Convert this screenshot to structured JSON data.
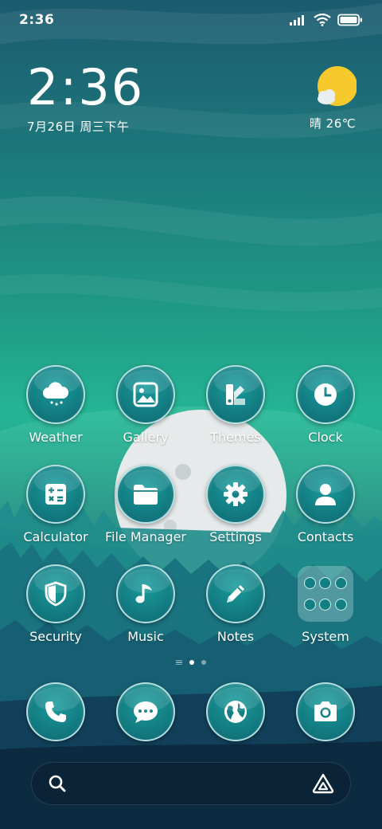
{
  "status_bar": {
    "time": "2:36",
    "icons": [
      "signal-icon",
      "wifi-icon",
      "battery-icon"
    ]
  },
  "clock_widget": {
    "time": "2:36",
    "date": "7月26日 周三下午"
  },
  "weather_widget": {
    "icon": "sun-cloud-icon",
    "text": "晴 26℃"
  },
  "apps": [
    {
      "name": "weather",
      "label": "Weather",
      "icon": "cloud-snow-icon"
    },
    {
      "name": "gallery",
      "label": "Gallery",
      "icon": "image-icon"
    },
    {
      "name": "themes",
      "label": "Themes",
      "icon": "brush-icon"
    },
    {
      "name": "clock",
      "label": "Clock",
      "icon": "clock-icon"
    },
    {
      "name": "calculator",
      "label": "Calculator",
      "icon": "calculator-icon"
    },
    {
      "name": "file-manager",
      "label": "File Manager",
      "icon": "folder-icon"
    },
    {
      "name": "settings",
      "label": "Settings",
      "icon": "gear-icon"
    },
    {
      "name": "contacts",
      "label": "Contacts",
      "icon": "person-icon"
    },
    {
      "name": "security",
      "label": "Security",
      "icon": "shield-icon"
    },
    {
      "name": "music",
      "label": "Music",
      "icon": "music-note-icon"
    },
    {
      "name": "notes",
      "label": "Notes",
      "icon": "pencil-icon"
    },
    {
      "name": "system",
      "label": "System",
      "icon": "folder-icon"
    }
  ],
  "dock": [
    {
      "name": "phone",
      "icon": "phone-icon"
    },
    {
      "name": "messages",
      "icon": "chat-icon"
    },
    {
      "name": "browser",
      "icon": "globe-icon"
    },
    {
      "name": "camera",
      "icon": "camera-icon"
    }
  ],
  "page_indicator": {
    "pages": 2,
    "current": 1
  },
  "search_bar": {
    "left_icon": "search-icon",
    "right_icon": "assistant-icon"
  },
  "colors": {
    "icon_fill": "#137f84",
    "icon_border": "#d2f0f0",
    "moon": "#e8ecec",
    "sun": "#f6c92c"
  }
}
